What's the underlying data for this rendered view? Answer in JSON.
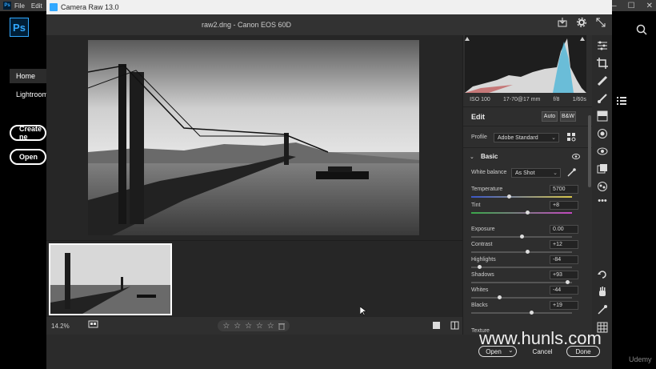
{
  "photoshop": {
    "menu": [
      "File",
      "Edit"
    ],
    "logo": "Ps",
    "nav": {
      "home": "Home",
      "lightroom": "Lightroom"
    },
    "buttons": {
      "create_new": "Create ne",
      "open": "Open"
    },
    "window_controls": [
      "—",
      "☐",
      "✕"
    ]
  },
  "camera_raw": {
    "window_title": "Camera Raw 13.0",
    "file_info": "raw2.dng  -  Canon EOS 60D",
    "zoom_level": "14.2%",
    "rating_stars": [
      "☆",
      "☆",
      "☆",
      "☆",
      "☆"
    ],
    "exif": {
      "iso": "ISO 100",
      "lens": "17-70@17 mm",
      "aperture": "f/8",
      "shutter": "1/60s"
    },
    "edit": {
      "title": "Edit",
      "auto_label": "Auto",
      "bw_label": "B&W",
      "profile_label": "Profile",
      "profile_value": "Adobe Standard",
      "basic_label": "Basic",
      "white_balance_label": "White balance",
      "white_balance_value": "As Shot",
      "sliders": [
        {
          "label": "Temperature",
          "value": "5700",
          "position": 0.38
        },
        {
          "label": "Tint",
          "value": "+8",
          "position": 0.56
        },
        {
          "label": "Exposure",
          "value": "0.00",
          "position": 0.5
        },
        {
          "label": "Contrast",
          "value": "+12",
          "position": 0.56
        },
        {
          "label": "Highlights",
          "value": "-84",
          "position": 0.08
        },
        {
          "label": "Shadows",
          "value": "+93",
          "position": 0.96
        },
        {
          "label": "Whites",
          "value": "-44",
          "position": 0.28
        },
        {
          "label": "Blacks",
          "value": "+19",
          "position": 0.6
        }
      ],
      "texture_label": "Texture"
    },
    "footer": {
      "open": "Open",
      "cancel": "Cancel",
      "done": "Done"
    }
  },
  "watermark": "www.hunls.com",
  "udemy": "Udemy"
}
